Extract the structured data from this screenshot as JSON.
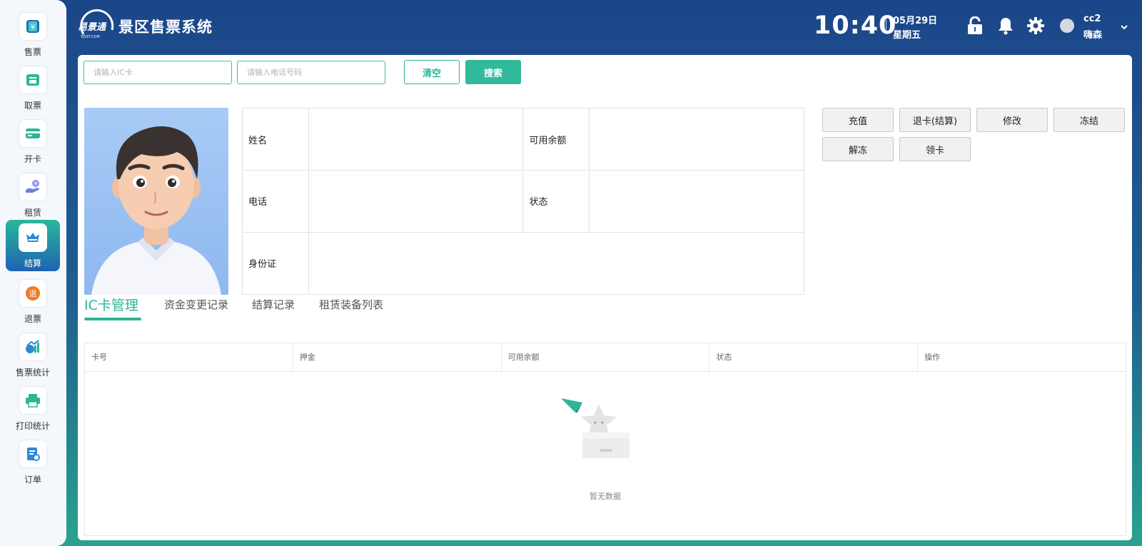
{
  "app": {
    "title": "景区售票系统"
  },
  "sidebar": {
    "items": [
      {
        "label": "售票"
      },
      {
        "label": "取票"
      },
      {
        "label": "开卡"
      },
      {
        "label": "租赁"
      },
      {
        "label": "结算",
        "active": true
      },
      {
        "label": "退票"
      },
      {
        "label": "售票统计"
      },
      {
        "label": "打印统计"
      },
      {
        "label": "订单"
      }
    ]
  },
  "header": {
    "time": "10:40",
    "date": "05月29日",
    "weekday": "星期五",
    "user_id": "cc2",
    "user_name": "嗨森",
    "icons": [
      "lock-icon",
      "bell-icon",
      "gear-icon"
    ]
  },
  "search": {
    "ic_placeholder": "请输入IC卡",
    "phone_placeholder": "请输入电话号码",
    "clear_label": "清空",
    "search_label": "搜索"
  },
  "info": {
    "name_label": "姓名",
    "name_value": "",
    "balance_label": "可用余额",
    "balance_value": "",
    "phone_label": "电话",
    "phone_value": "",
    "status_label": "状态",
    "status_value": "",
    "idcard_label": "身份证",
    "idcard_value": ""
  },
  "actions": {
    "recharge": "充值",
    "refund_card": "退卡(结算)",
    "modify": "修改",
    "freeze": "冻结",
    "unfreeze": "解冻",
    "claim_card": "领卡"
  },
  "tabs": [
    {
      "label": "IC卡管理",
      "active": true
    },
    {
      "label": "资金变更记录"
    },
    {
      "label": "结算记录"
    },
    {
      "label": "租赁装备列表"
    }
  ],
  "table": {
    "columns": [
      "卡号",
      "押金",
      "可用余额",
      "状态",
      "操作"
    ],
    "rows": [],
    "empty_text": "暂无数据"
  },
  "colors": {
    "accent": "#2cb597",
    "header_top": "#1b4689",
    "header_bottom": "#28a38f"
  }
}
